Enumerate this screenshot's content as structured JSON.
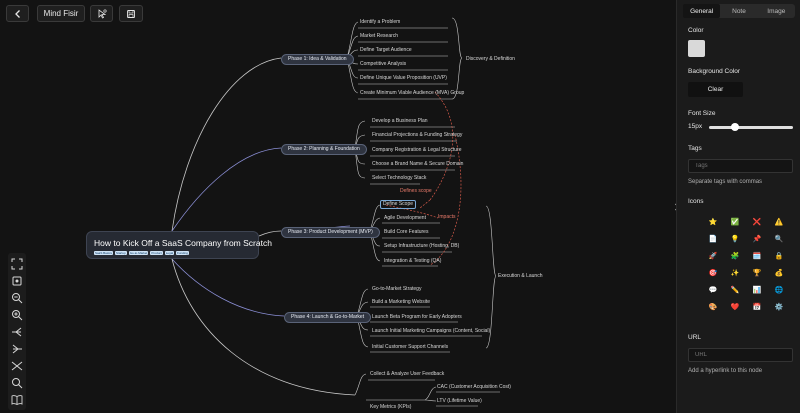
{
  "toolbar": {
    "back_icon": "chevron-left-icon",
    "title_button": "Mind Fisir",
    "cursor_icon": "pointer-settings-icon",
    "save_icon": "floppy-disk-icon"
  },
  "mindmap": {
    "root": {
      "title": "How to Kick Off a SaaS Company from Scratch",
      "tags": [
        "SaaS Basics",
        "Startup",
        "Go-to-Market",
        "Product",
        "Legal",
        "Funding"
      ]
    },
    "phases": [
      "Phase 1: Idea & Validation",
      "Phase 2: Planning & Foundation",
      "Phase 3: Product Development (MVP)",
      "Phase 4: Launch & Go-to-Market"
    ],
    "phase1_items": [
      "Identify a Problem",
      "Market Research",
      "Define Target Audience",
      "Competitive Analysis",
      "Define Unique Value Proposition (UVP)",
      "Create Minimum Viable Audience (MVA) Group"
    ],
    "phase2_items": [
      "Develop a Business Plan",
      "Financial Projections & Funding Strategy",
      "Company Registration & Legal Structure",
      "Choose a Brand Name & Secure Domain",
      "Select Technology Stack"
    ],
    "phase3_items": [
      "Define Scope",
      "Agile Development",
      "Build Core Features",
      "Setup Infrastructure (Hosting, DB)",
      "Integration & Testing (QA)"
    ],
    "phase4_items": [
      "Go-to-Market Strategy",
      "Build a Marketing Website",
      "Launch Beta Program for Early Adopters",
      "Launch Initial Marketing Campaigns (Content, Social)",
      "Initial Customer Support Channels"
    ],
    "bottom_items": [
      "Collect & Analyze User Feedback",
      "Key Metrics (KPIs)",
      "CAC (Customer Acquisition Cost)",
      "LTV (Lifetime Value)"
    ],
    "group_labels": {
      "discovery": "Discovery & Definition",
      "execution": "Execution & Launch",
      "defines_scope": "Defines scope",
      "impacts": "Impacts"
    }
  },
  "left_tools": [
    "fullscreen-icon",
    "fit-view-icon",
    "zoom-out-icon",
    "zoom-in-icon",
    "layout-right-icon",
    "layout-left-icon",
    "layout-both-icon",
    "search-icon",
    "book-icon"
  ],
  "panel": {
    "tabs": [
      "General",
      "Note",
      "Image"
    ],
    "active_tab": "General",
    "color_label": "Color",
    "color_value": "#d9d9d9",
    "background_label": "Background Color",
    "clear_button": "Clear",
    "font_size_label": "Font Size",
    "font_size_value": "15px",
    "font_size_level": 0.31,
    "tags_label": "Tags",
    "tags_placeholder": "Tags",
    "tags_helper": "Separate tags with commas",
    "icons_label": "Icons",
    "icons": [
      "⭐",
      "✅",
      "❌",
      "⚠️",
      "📄",
      "💡",
      "📌",
      "🔍",
      "🚀",
      "🧩",
      "🗓️",
      "🔒",
      "🎯",
      "✨",
      "🏆",
      "💰",
      "💬",
      "✏️",
      "📊",
      "🌐",
      "🎨",
      "❤️",
      "📅",
      "⚙️"
    ],
    "url_label": "URL",
    "url_placeholder": "URL",
    "url_helper": "Add a hyperlink to this node"
  }
}
